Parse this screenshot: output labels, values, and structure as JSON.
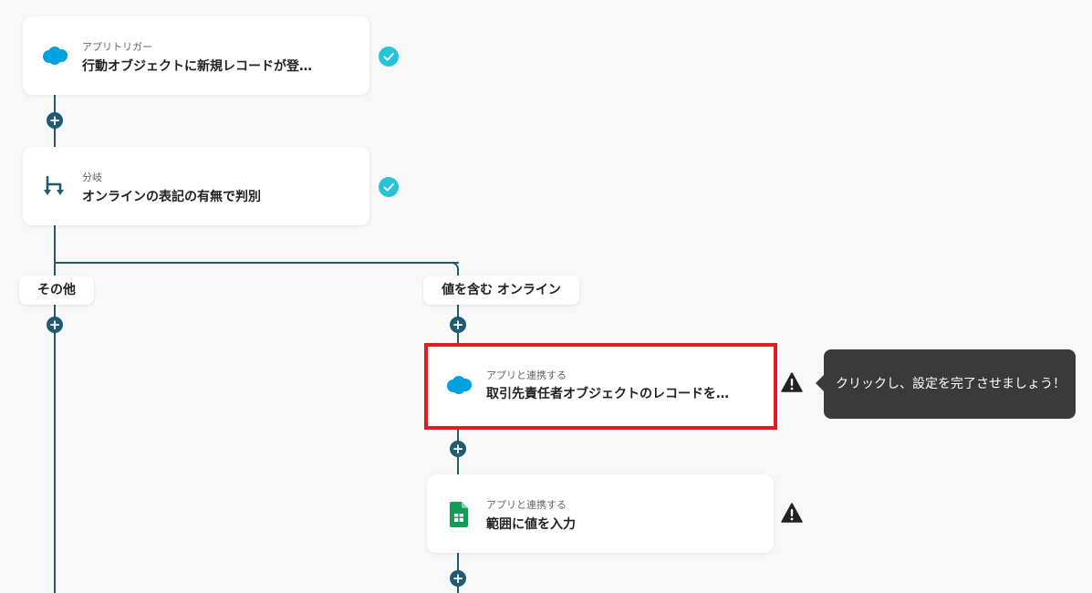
{
  "flow": {
    "trigger": {
      "subtitle": "アプリトリガー",
      "title": "行動オブジェクトに新規レコードが登…",
      "icon": "salesforce-icon",
      "status": "completed"
    },
    "branch": {
      "subtitle": "分岐",
      "title": "オンラインの表記の有無で判別",
      "icon": "branch-icon",
      "status": "completed"
    },
    "branch_labels": {
      "other": "その他",
      "contains": "値を含む オンライン"
    },
    "step_contact": {
      "subtitle": "アプリと連携する",
      "title": "取引先責任者オブジェクトのレコードを…",
      "icon": "salesforce-icon",
      "status": "warning"
    },
    "step_sheet": {
      "subtitle": "アプリと連携する",
      "title": "範囲に値を入力",
      "icon": "google-sheets-icon",
      "status": "warning"
    },
    "add_step_symbol": "+"
  },
  "tooltip": {
    "text": "クリックし、設定を完了させましょう！"
  },
  "colors": {
    "line": "#1f5b73",
    "check": "#27c3d8",
    "highlight": "#e01e1e",
    "tooltip_bg": "#3a3a3a",
    "salesforce": "#00a1e0",
    "sheets": "#0f9d58"
  }
}
